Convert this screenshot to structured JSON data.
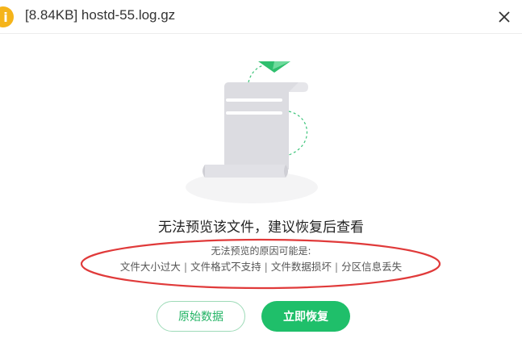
{
  "dialog": {
    "title": "[8.84KB] hostd-55.log.gz",
    "info_icon_glyph": "i",
    "close_icon": "close-icon"
  },
  "preview": {
    "headline": "无法预览该文件，建议恢复后查看",
    "reason_title": "无法预览的原因可能是:",
    "reasons": [
      "文件大小过大",
      "文件格式不支持",
      "文件数据损坏",
      "分区信息丢失"
    ],
    "separator": "|"
  },
  "buttons": {
    "raw_data": "原始数据",
    "recover_now": "立即恢复"
  },
  "colors": {
    "accent_green": "#1fbf6a",
    "info_orange": "#f5b41a",
    "annotation_red": "#e03a3a"
  }
}
